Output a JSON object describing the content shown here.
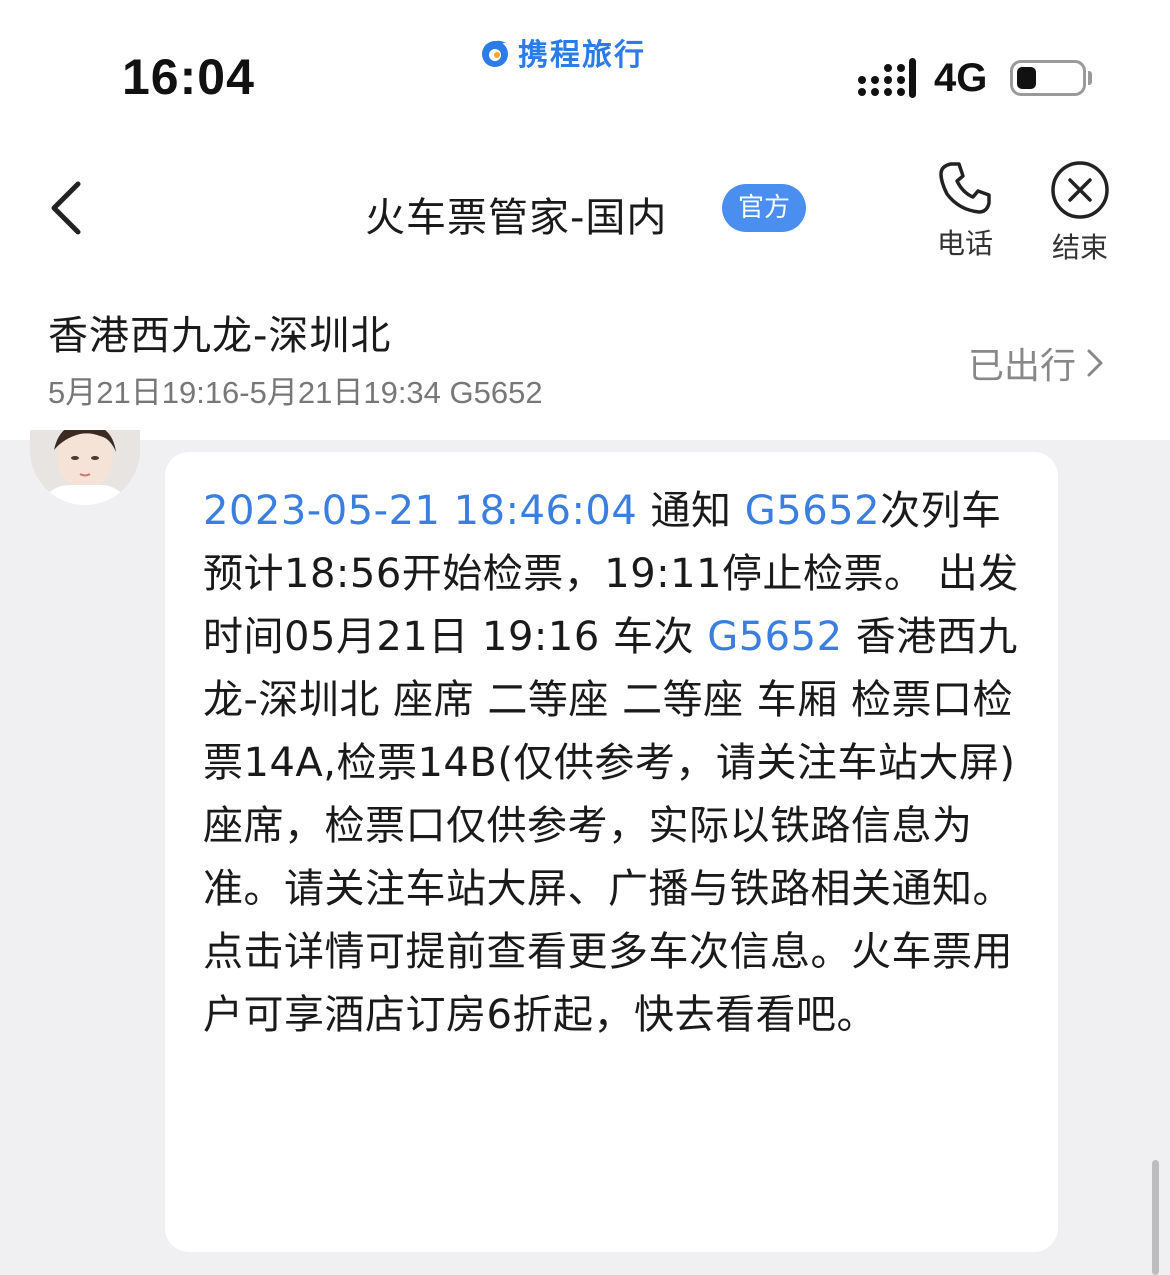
{
  "status_bar": {
    "time": "16:04",
    "brand": "携程旅行",
    "network": "4G",
    "battery_level": 0.3
  },
  "header": {
    "title": "火车票管家-国内",
    "badge": "官方",
    "phone_label": "电话",
    "end_label": "结束"
  },
  "trip": {
    "route": "香港西九龙-深圳北",
    "time": "5月21日19:16-5月21日19:34 G5652",
    "status": "已出行"
  },
  "message": {
    "timestamp": "2023-05-21 18:46:04",
    "t1": " 通知 ",
    "train1": "G5652",
    "t2": "次列车预计18:56开始检票，19:11停止检票。 出发时间05月21日 19:16 车次 ",
    "train2": "G5652",
    "t3": " 香港西九龙-深圳北 座席          二等座                                         二等座     车厢          检票口检票14A,检票14B(仅供参考，请关注车站大屏) 座席，检票口仅供参考，实际以铁路信息为准。请关注车站大屏、广播与铁路相关通知。点击详情可提前查看更多车次信息。火车票用户可享酒店订房6折起，快去看看吧。"
  },
  "colors": {
    "brand_blue": "#2b7be8",
    "link_blue": "#3a7fe0",
    "badge_blue": "#4a8ff0",
    "chat_bg": "#f0f0f2"
  },
  "icons": [
    "back-chevron-icon",
    "phone-icon",
    "close-circle-icon",
    "chevron-right-icon",
    "signal-icon",
    "battery-icon",
    "brand-logo-icon"
  ]
}
